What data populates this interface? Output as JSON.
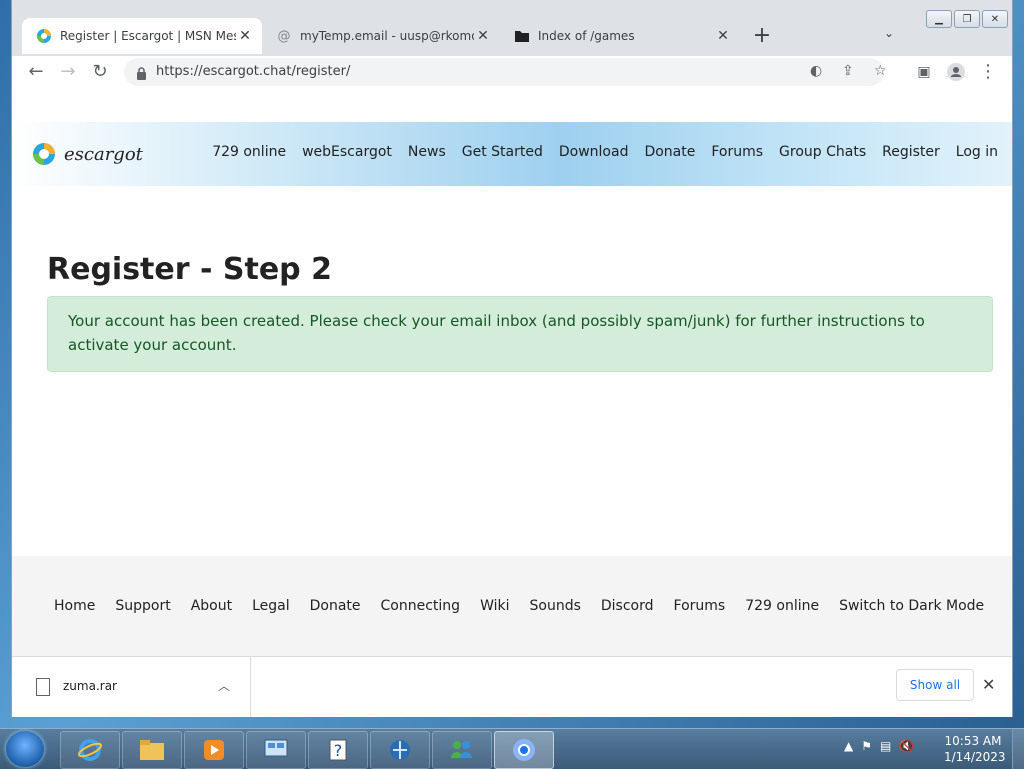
{
  "browser": {
    "tabs": [
      {
        "title": "Register | Escargot | MSN Messen",
        "icon": "escargot-favicon",
        "active": true
      },
      {
        "title": "myTemp.email - uusp@rkomo.co",
        "icon": "at-sign-icon",
        "active": false
      },
      {
        "title": "Index of /games",
        "icon": "folder-icon",
        "active": false
      }
    ],
    "url": "https://escargot.chat/register/"
  },
  "site": {
    "brand": "escargot",
    "nav": [
      "729 online",
      "webEscargot",
      "News",
      "Get Started",
      "Download",
      "Donate",
      "Forums",
      "Group Chats",
      "Register",
      "Log in"
    ],
    "title": "Register - Step 2",
    "alert": "Your account has been created. Please check your email inbox (and possibly spam/junk) for further instructions to activate your account.",
    "footer": [
      "Home",
      "Support",
      "About",
      "Legal",
      "Donate",
      "Connecting",
      "Wiki",
      "Sounds",
      "Discord",
      "Forums",
      "729 online",
      "Switch to Dark Mode"
    ]
  },
  "downloads": {
    "file": "zuma.rar",
    "show_all": "Show all"
  },
  "taskbar": {
    "time": "10:53 AM",
    "date": "1/14/2023"
  },
  "colors": {
    "alert_bg": "#d4edda",
    "alert_text": "#155724",
    "link_blue": "#1a73e8"
  }
}
